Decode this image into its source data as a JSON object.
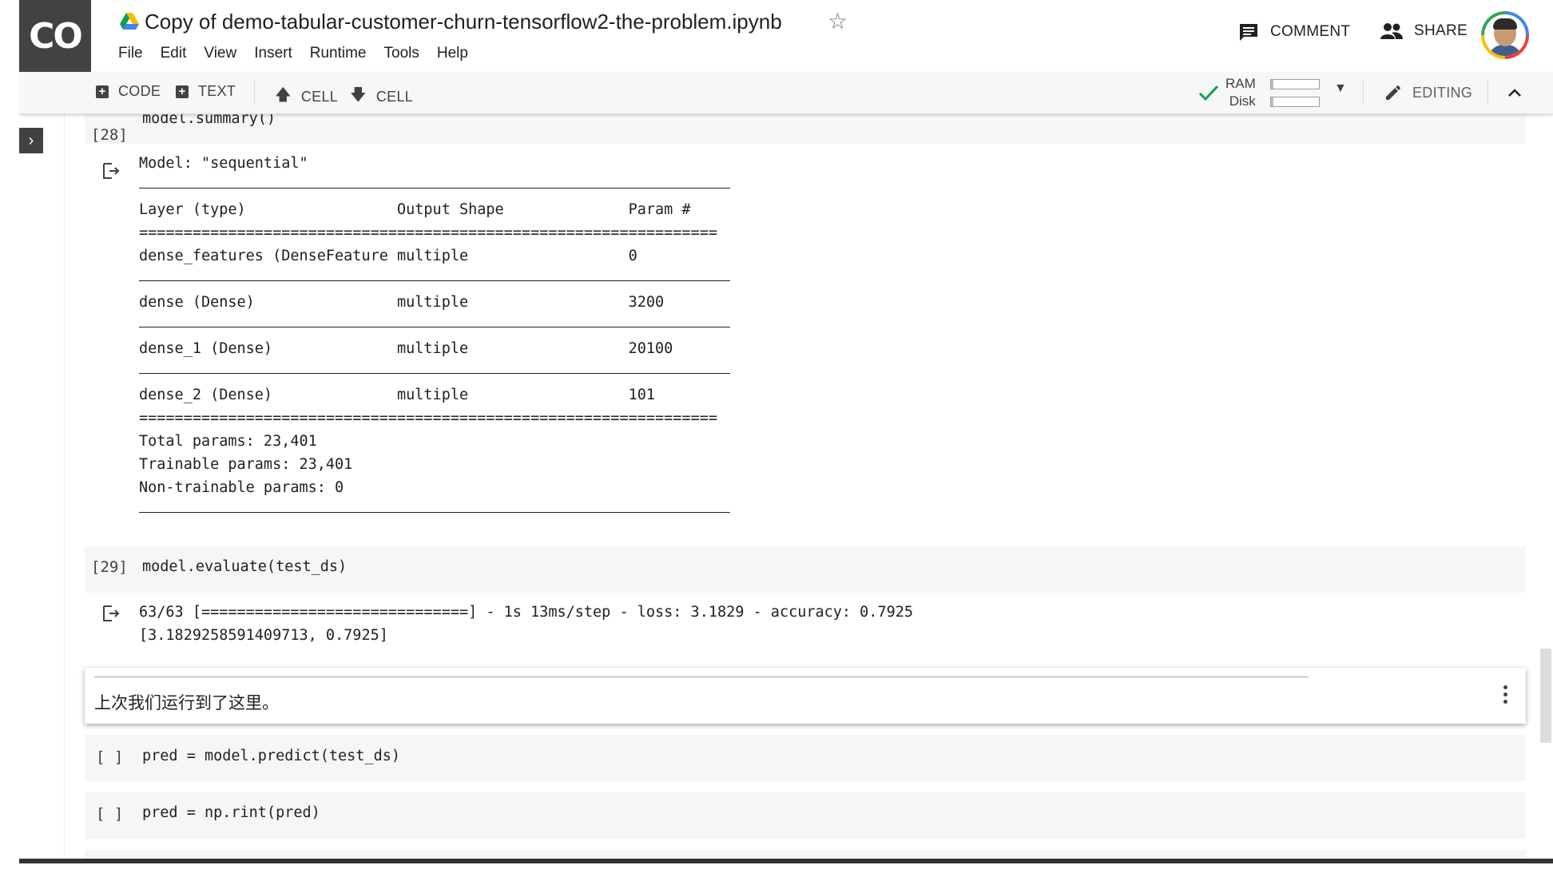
{
  "app": {
    "logo": "CO"
  },
  "header": {
    "title": "Copy of demo-tabular-customer-churn-tensorflow2-the-problem.ipynb",
    "menu": [
      "File",
      "Edit",
      "View",
      "Insert",
      "Runtime",
      "Tools",
      "Help"
    ],
    "comment_label": "COMMENT",
    "share_label": "SHARE"
  },
  "toolbar": {
    "add_code": "CODE",
    "add_text": "TEXT",
    "cell_up": "CELL",
    "cell_down": "CELL",
    "ram_label": "RAM",
    "disk_label": "Disk",
    "ram_usage": 0.05,
    "disk_usage": 0.05,
    "editing_label": "EDITING"
  },
  "cells": [
    {
      "exec_count": "[28]",
      "code": "model.summary()",
      "output_lines": [
        "Model: \"sequential\"",
        "---",
        "Layer (type)                 Output Shape              Param #   ",
        "=================================================================",
        "dense_features (DenseFeature multiple                  0         ",
        "---",
        "dense (Dense)                multiple                  3200      ",
        "---",
        "dense_1 (Dense)              multiple                  20100     ",
        "---",
        "dense_2 (Dense)              multiple                  101       ",
        "=================================================================",
        "Total params: 23,401",
        "Trainable params: 23,401",
        "Non-trainable params: 0",
        "---"
      ]
    },
    {
      "exec_count": "[29]",
      "code": "model.evaluate(test_ds)",
      "output_lines": [
        "63/63 [==============================] - 1s 13ms/step - loss: 3.1829 - accuracy: 0.7925",
        "[3.1829258591409713, 0.7925]"
      ]
    },
    {
      "text": "上次我们运行到了这里。"
    },
    {
      "exec_count": "[ ]",
      "code": "pred = model.predict(test_ds)"
    },
    {
      "exec_count": "[ ]",
      "code": "pred = np.rint(pred)"
    }
  ],
  "colors": {
    "logo_bg": "#424242",
    "checkmark": "#0f9d58",
    "cell_bg": "#f6f6f6"
  }
}
